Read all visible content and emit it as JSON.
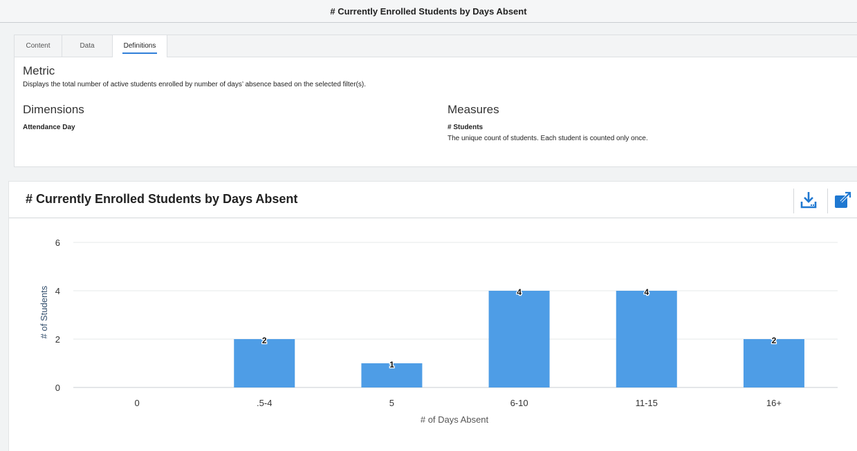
{
  "top_title": "# Currently Enrolled Students by Days Absent",
  "tabs": [
    {
      "label": "Content"
    },
    {
      "label": "Data"
    },
    {
      "label": "Definitions"
    }
  ],
  "definitions": {
    "metric_heading": "Metric",
    "metric_text": "Displays the total number of active students enrolled by number of days’ absence based on the selected filter(s).",
    "dimensions_heading": "Dimensions",
    "dimension_name": "Attendance Day",
    "measures_heading": "Measures",
    "measure_name": "# Students",
    "measure_text": "The unique count of students. Each student is counted only once."
  },
  "chart_card": {
    "title": "# Currently Enrolled Students by Days Absent",
    "download_icon": "download-icon",
    "expand_icon": "external-link-icon"
  },
  "colors": {
    "bar": "#4e9de6",
    "icon": "#1f78d1"
  },
  "chart_data": {
    "type": "bar",
    "categories": [
      "0",
      ".5-4",
      "5",
      "6-10",
      "11-15",
      "16+"
    ],
    "values": [
      0,
      2,
      1,
      4,
      4,
      2
    ],
    "data_labels": [
      "",
      "2",
      "1",
      "4",
      "4",
      "2"
    ],
    "xlabel": "# of Days Absent",
    "ylabel": "# of Students",
    "ylim": [
      0,
      6
    ],
    "yticks": [
      "0",
      "2",
      "4",
      "6"
    ],
    "grid": true
  }
}
